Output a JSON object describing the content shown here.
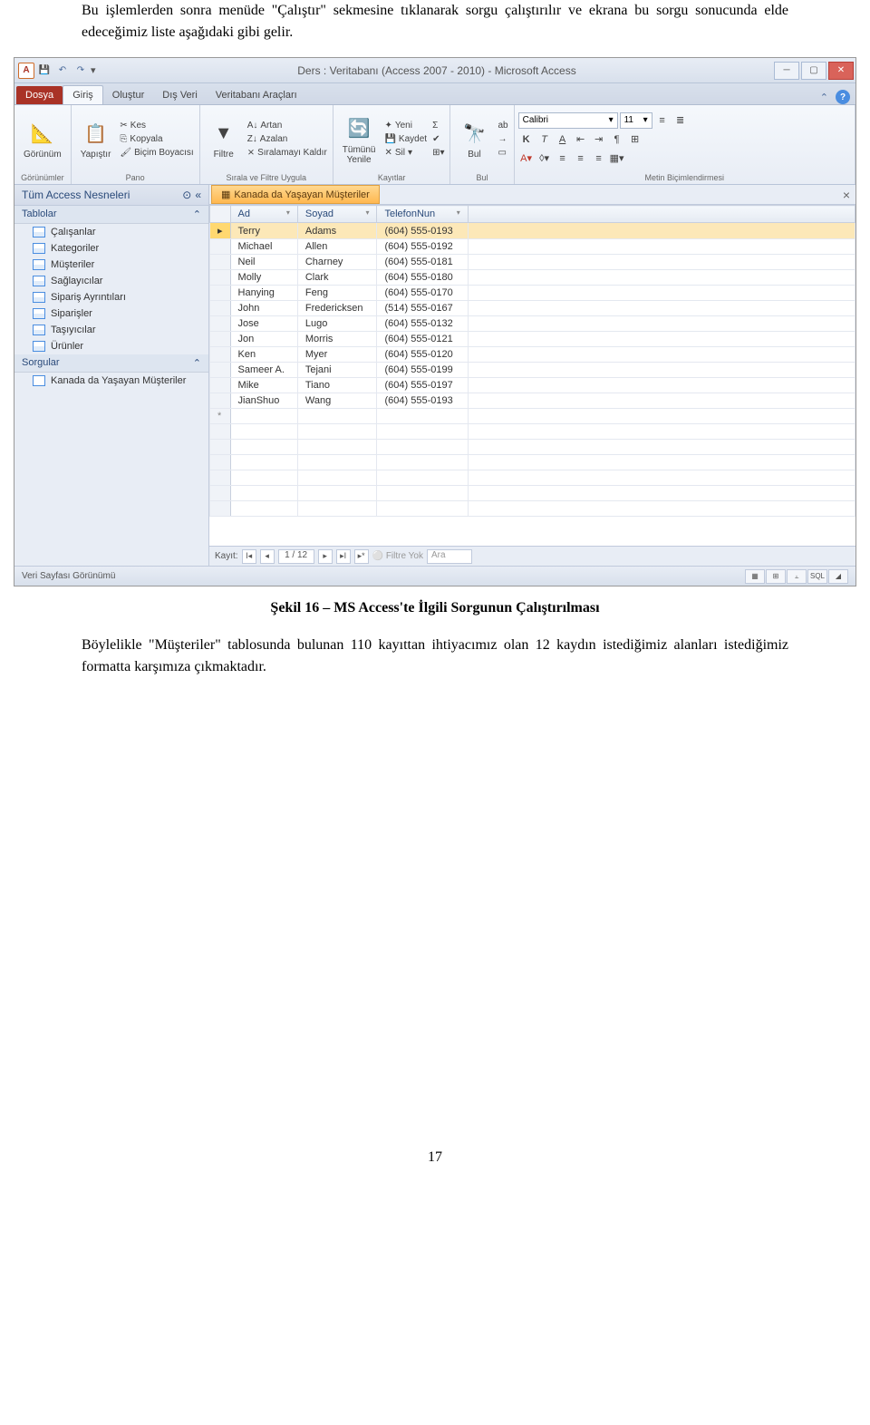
{
  "doc": {
    "para1": "Bu işlemlerden sonra menüde \"Çalıştır\" sekmesine tıklanarak sorgu çalıştırılır ve ekrana bu sorgu sonucunda elde edeceğimiz liste aşağıdaki gibi gelir.",
    "caption": "Şekil 16 – MS Access'te İlgili Sorgunun Çalıştırılması",
    "para2": "Böylelikle \"Müşteriler\" tablosunda bulunan 110 kayıttan ihtiyacımız olan 12 kaydın istediğimiz alanları istediğimiz formatta karşımıza çıkmaktadır.",
    "pageNum": "17"
  },
  "window": {
    "appLetter": "A",
    "title": "Ders : Veritabanı (Access 2007 - 2010) - Microsoft Access"
  },
  "tabs": {
    "file": "Dosya",
    "home": "Giriş",
    "create": "Oluştur",
    "external": "Dış Veri",
    "dbtools": "Veritabanı Araçları"
  },
  "ribbon": {
    "views": {
      "view": "Görünüm",
      "title": "Görünümler"
    },
    "clipboard": {
      "paste": "Yapıştır",
      "cut": "Kes",
      "copy": "Kopyala",
      "painter": "Biçim Boyacısı",
      "title": "Pano"
    },
    "sort": {
      "filter": "Filtre",
      "asc": "Artan",
      "desc": "Azalan",
      "clear": "Sıralamayı Kaldır",
      "title": "Sırala ve Filtre Uygula"
    },
    "records": {
      "refresh": "Tümünü\nYenile",
      "new": "Yeni",
      "save": "Kaydet",
      "delete": "Sil",
      "sum": "Σ",
      "title": "Kayıtlar"
    },
    "find": {
      "find": "Bul",
      "title": "Bul"
    },
    "font": {
      "name": "Calibri",
      "size": "11",
      "title": "Metin Biçimlendirmesi"
    }
  },
  "nav": {
    "header": "Tüm Access Nesneleri",
    "groups": {
      "tables": "Tablolar",
      "queries": "Sorgular"
    },
    "tables": [
      "Çalışanlar",
      "Kategoriler",
      "Müşteriler",
      "Sağlayıcılar",
      "Sipariş Ayrıntıları",
      "Siparişler",
      "Taşıyıcılar",
      "Ürünler"
    ],
    "queries": [
      "Kanada da Yaşayan Müşteriler"
    ]
  },
  "tab": {
    "title": "Kanada da Yaşayan Müşteriler"
  },
  "grid": {
    "cols": [
      "Ad",
      "Soyad",
      "TelefonNun"
    ],
    "rows": [
      [
        "Terry",
        "Adams",
        "(604) 555-0193"
      ],
      [
        "Michael",
        "Allen",
        "(604) 555-0192"
      ],
      [
        "Neil",
        "Charney",
        "(604) 555-0181"
      ],
      [
        "Molly",
        "Clark",
        "(604) 555-0180"
      ],
      [
        "Hanying",
        "Feng",
        "(604) 555-0170"
      ],
      [
        "John",
        "Fredericksen",
        "(514) 555-0167"
      ],
      [
        "Jose",
        "Lugo",
        "(604) 555-0132"
      ],
      [
        "Jon",
        "Morris",
        "(604) 555-0121"
      ],
      [
        "Ken",
        "Myer",
        "(604) 555-0120"
      ],
      [
        "Sameer A.",
        "Tejani",
        "(604) 555-0199"
      ],
      [
        "Mike",
        "Tiano",
        "(604) 555-0197"
      ],
      [
        "JianShuo",
        "Wang",
        "(604) 555-0193"
      ]
    ]
  },
  "recordnav": {
    "label": "Kayıt:",
    "pos": "1 / 12",
    "nofilter": "Filtre Yok",
    "search": "Ara"
  },
  "status": {
    "text": "Veri Sayfası Görünümü",
    "sql": "SQL"
  }
}
